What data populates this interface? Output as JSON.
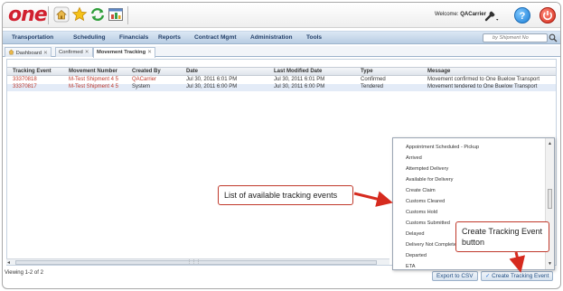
{
  "header": {
    "logo_text": "one",
    "welcome_prefix": "Welcome:",
    "welcome_user": "QACarrier",
    "help_glyph": "?",
    "icons": [
      "home-icon",
      "favorites-star-icon",
      "refresh-icon",
      "report-icon",
      "tools-icon",
      "help-icon",
      "logout-power-icon"
    ],
    "colors": {
      "logo": "#d1202f",
      "nav_text": "#25416a",
      "link_red": "#c0392b",
      "callout_border": "#c0392b"
    }
  },
  "nav": {
    "items": [
      "Transportation",
      "Scheduling",
      "Financials",
      "Reports",
      "Contract Mgmt",
      "Administration",
      "Tools"
    ],
    "search_placeholder": "by Shipment No"
  },
  "tabs": [
    {
      "label": "Dashboard",
      "close": "✕"
    },
    {
      "label": "Confirmed",
      "close": "✕"
    },
    {
      "label": "Movement Tracking",
      "close": "✕",
      "active": true
    }
  ],
  "table": {
    "columns": [
      "Tracking Event",
      "Movement Number",
      "Created By",
      "Date",
      "Last Modified Date",
      "Type",
      "Message"
    ],
    "rows": [
      [
        "33370818",
        "M-Test Shipment 4 5",
        "QACarrier",
        "Jul 30, 2011 6:01 PM",
        "Jul 30, 2011 6:01 PM",
        "Confirmed",
        "Movement confirmed to One Buelow Transport"
      ],
      [
        "33370817",
        "M-Test Shipment 4 5",
        "System",
        "Jul 30, 2011 6:00 PM",
        "Jul 30, 2011 6:00 PM",
        "Tendered",
        "Movement tendered to One Buelow Transport"
      ]
    ]
  },
  "footer": {
    "viewing": "Viewing 1-2 of 2",
    "export_label": "Export to CSV",
    "create_label": "Create Tracking Event"
  },
  "dropdown": {
    "items": [
      "Appointment Scheduled - Pickup",
      "Arrived",
      "Attempted Delivery",
      "Available for Delivery",
      "Create Claim",
      "Customs Cleared",
      "Customs Hold",
      "Customs Submitted",
      "Delayed",
      "Delivery Not Completed",
      "Departed",
      "ETA"
    ]
  },
  "callouts": {
    "list": "List of available tracking events",
    "button": "Create Tracking Event button"
  }
}
